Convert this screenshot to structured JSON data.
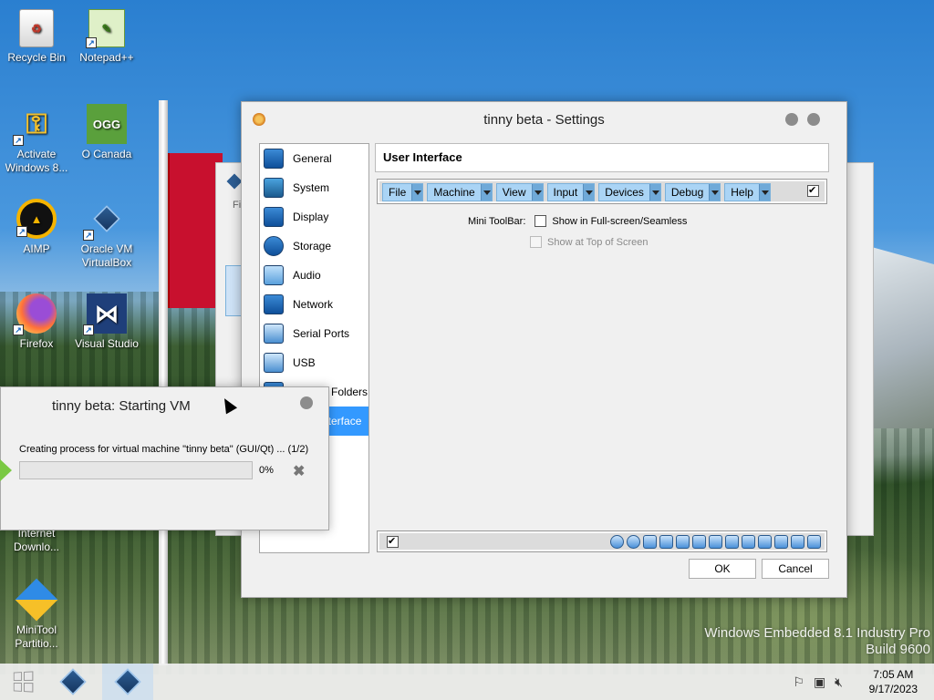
{
  "desktop": {
    "icons": [
      {
        "label": "Recycle Bin",
        "icon": "recycle-bin-icon"
      },
      {
        "label": "Notepad++",
        "icon": "notepad-plus-plus-icon"
      },
      {
        "label": "Activate Windows 8...",
        "icon": "key-shield-icon"
      },
      {
        "label": "O Canada",
        "glyph": "OGG",
        "icon": "ogg-file-icon"
      },
      {
        "label": "AIMP",
        "icon": "aimp-icon"
      },
      {
        "label": "Oracle VM VirtualBox",
        "icon": "virtualbox-icon"
      },
      {
        "label": "Firefox",
        "icon": "firefox-icon"
      },
      {
        "label": "Visual Studio",
        "icon": "visual-studio-icon"
      },
      {
        "label": "Internet Downlo...",
        "icon": "internet-download-icon"
      },
      {
        "label": "MiniTool Partitio...",
        "icon": "minitool-icon"
      }
    ],
    "watermark": {
      "line1": "Windows Embedded 8.1 Industry Pro",
      "line2": "Build 9600"
    }
  },
  "settings_window": {
    "title": "tinny beta - Settings",
    "nav_items": [
      {
        "label": "General",
        "icon": "general-icon"
      },
      {
        "label": "System",
        "icon": "system-icon"
      },
      {
        "label": "Display",
        "icon": "display-icon"
      },
      {
        "label": "Storage",
        "icon": "storage-icon"
      },
      {
        "label": "Audio",
        "icon": "audio-icon"
      },
      {
        "label": "Network",
        "icon": "network-icon"
      },
      {
        "label": "Serial Ports",
        "icon": "serial-ports-icon"
      },
      {
        "label": "USB",
        "icon": "usb-icon"
      },
      {
        "label": "Shared Folders",
        "icon": "shared-folders-icon"
      },
      {
        "label": "User Interface",
        "icon": "user-interface-icon",
        "selected": true
      }
    ],
    "section_title": "User Interface",
    "menu_bar_items": [
      "File",
      "Machine",
      "View",
      "Input",
      "Devices",
      "Debug",
      "Help"
    ],
    "menu_bar_enabled": true,
    "mini_toolbar_label": "Mini ToolBar:",
    "option_fullscreen": {
      "label": "Show in Full-screen/Seamless",
      "checked": false
    },
    "option_top": {
      "label": "Show at Top of Screen",
      "checked": false,
      "disabled": true
    },
    "status_bar_enabled": true,
    "ok_label": "OK",
    "cancel_label": "Cancel"
  },
  "vm_dialog": {
    "title": "tinny beta: Starting VM",
    "message": "Creating process for virtual machine \"tinny beta\" (GUI/Qt) ... (1/2)",
    "progress_text": "0%",
    "progress": 0
  },
  "back_window": {
    "partial_text": "Fi"
  },
  "taskbar": {
    "time": "7:05 AM",
    "date": "9/17/2023",
    "apps": [
      "virtualbox-manager",
      "virtualbox-vm"
    ]
  }
}
